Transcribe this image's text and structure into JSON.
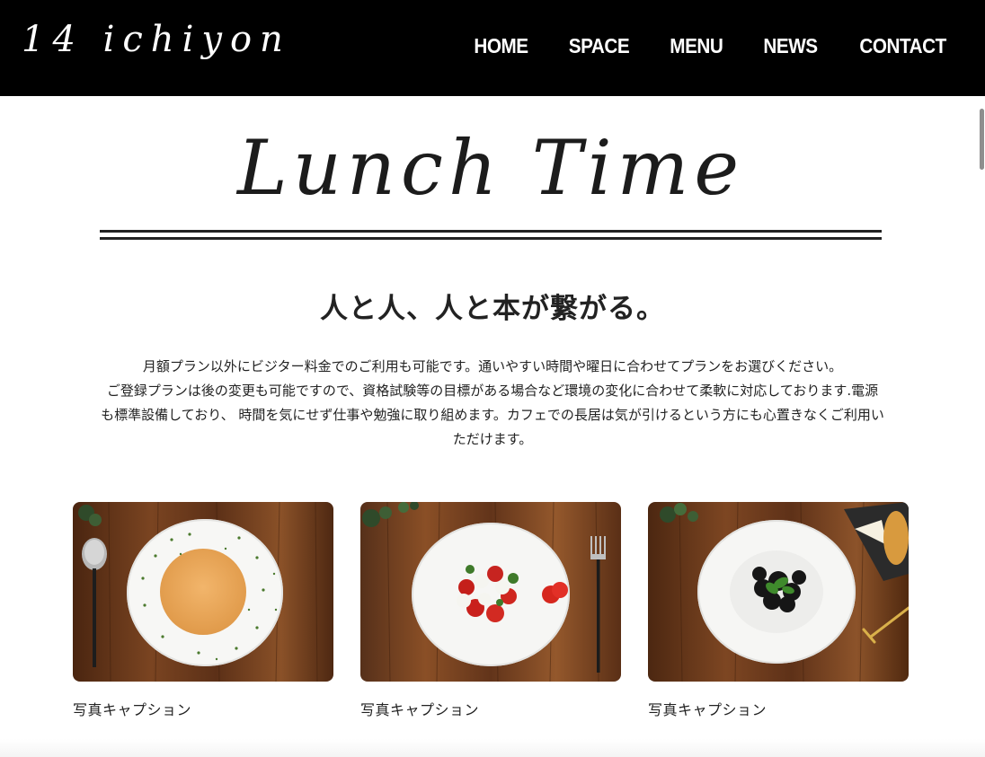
{
  "header": {
    "logo": "14 ichiyon",
    "nav": [
      {
        "label": "HOME"
      },
      {
        "label": "SPACE"
      },
      {
        "label": "MENU"
      },
      {
        "label": "NEWS"
      },
      {
        "label": "CONTACT"
      }
    ]
  },
  "section": {
    "title": "Lunch Time",
    "tagline": "人と人、人と本が繋がる。",
    "intro": [
      "月額プラン以外にビジター料金でのご利用も可能です。通いやすい時間や曜日に合わせてプランをお選びください。",
      "ご登録プランは後の変更も可能ですので、資格試験等の目標がある場合など環境の変化に合わせて柔軟に対応しております.電源",
      "も標準設備しており、 時間を気にせず仕事や勉強に取り組めます。カフェでの長居は気が引けるという方にも心置きなくご利用い",
      "ただけます。"
    ]
  },
  "cards": [
    {
      "caption": "写真キャプション",
      "photo": "soup-bowl-photo"
    },
    {
      "caption": "写真キャプション",
      "photo": "caprese-salad-photo"
    },
    {
      "caption": "写真キャプション",
      "photo": "black-pasta-photo"
    }
  ],
  "colors": {
    "header_bg": "#000000",
    "header_text": "#ffffff",
    "body_text": "#222222",
    "table_wood": "#6b3a1c"
  }
}
